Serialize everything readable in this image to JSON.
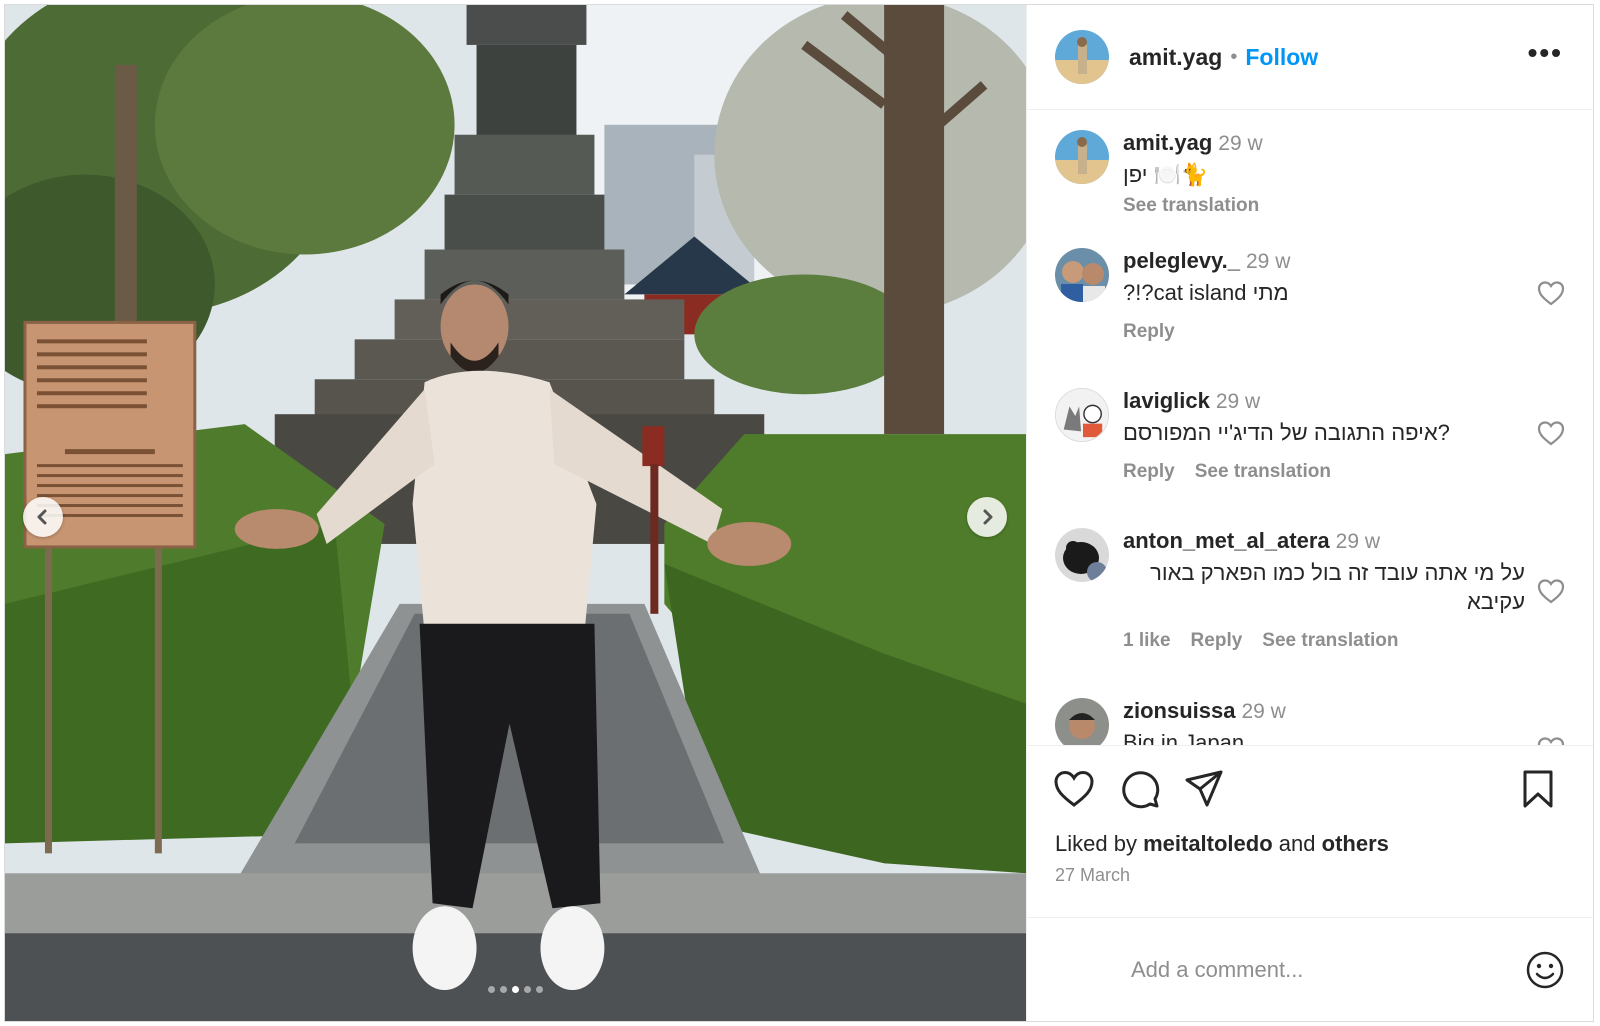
{
  "post": {
    "author": "amit.yag",
    "separator": "•",
    "follow_label": "Follow",
    "more_label": "•••"
  },
  "caption": {
    "user": "amit.yag",
    "time": "29 w",
    "text": "יפן 🍽️🐈",
    "translate_label": "See translation"
  },
  "comments": [
    {
      "user": "peleglevy._",
      "time": "29 w",
      "text": "?!?cat island מתי",
      "actions": [
        "Reply"
      ]
    },
    {
      "user": "laviglick",
      "time": "29 w",
      "text": "איפה התגובה של הדיג'יי המפורסם?",
      "actions": [
        "Reply",
        "See translation"
      ]
    },
    {
      "user": "anton_met_al_atera",
      "time": "29 w",
      "text": "על מי אתה עובד זה בול כמו הפארק באור עקיבא",
      "actions": [
        "1 like",
        "Reply",
        "See translation"
      ]
    },
    {
      "user": "zionsuissa",
      "time": "29 w",
      "text": "Big in Japan",
      "actions": []
    }
  ],
  "likes": {
    "prefix": "Liked by",
    "user": "meitaltoledo",
    "joiner": "and",
    "suffix": "others"
  },
  "date": "27 March",
  "comment_input": {
    "placeholder": "Add a comment..."
  },
  "carousel": {
    "slides": 5,
    "active_index": 2
  },
  "icons": {
    "prev": "chevron-left-icon",
    "next": "chevron-right-icon",
    "like": "heart-icon",
    "comment": "comment-bubble-icon",
    "share": "paper-plane-icon",
    "save": "bookmark-icon",
    "emoji": "smiley-icon"
  },
  "colors": {
    "follow": "#0095f6",
    "muted": "#8e8e8e",
    "text": "#262626"
  }
}
